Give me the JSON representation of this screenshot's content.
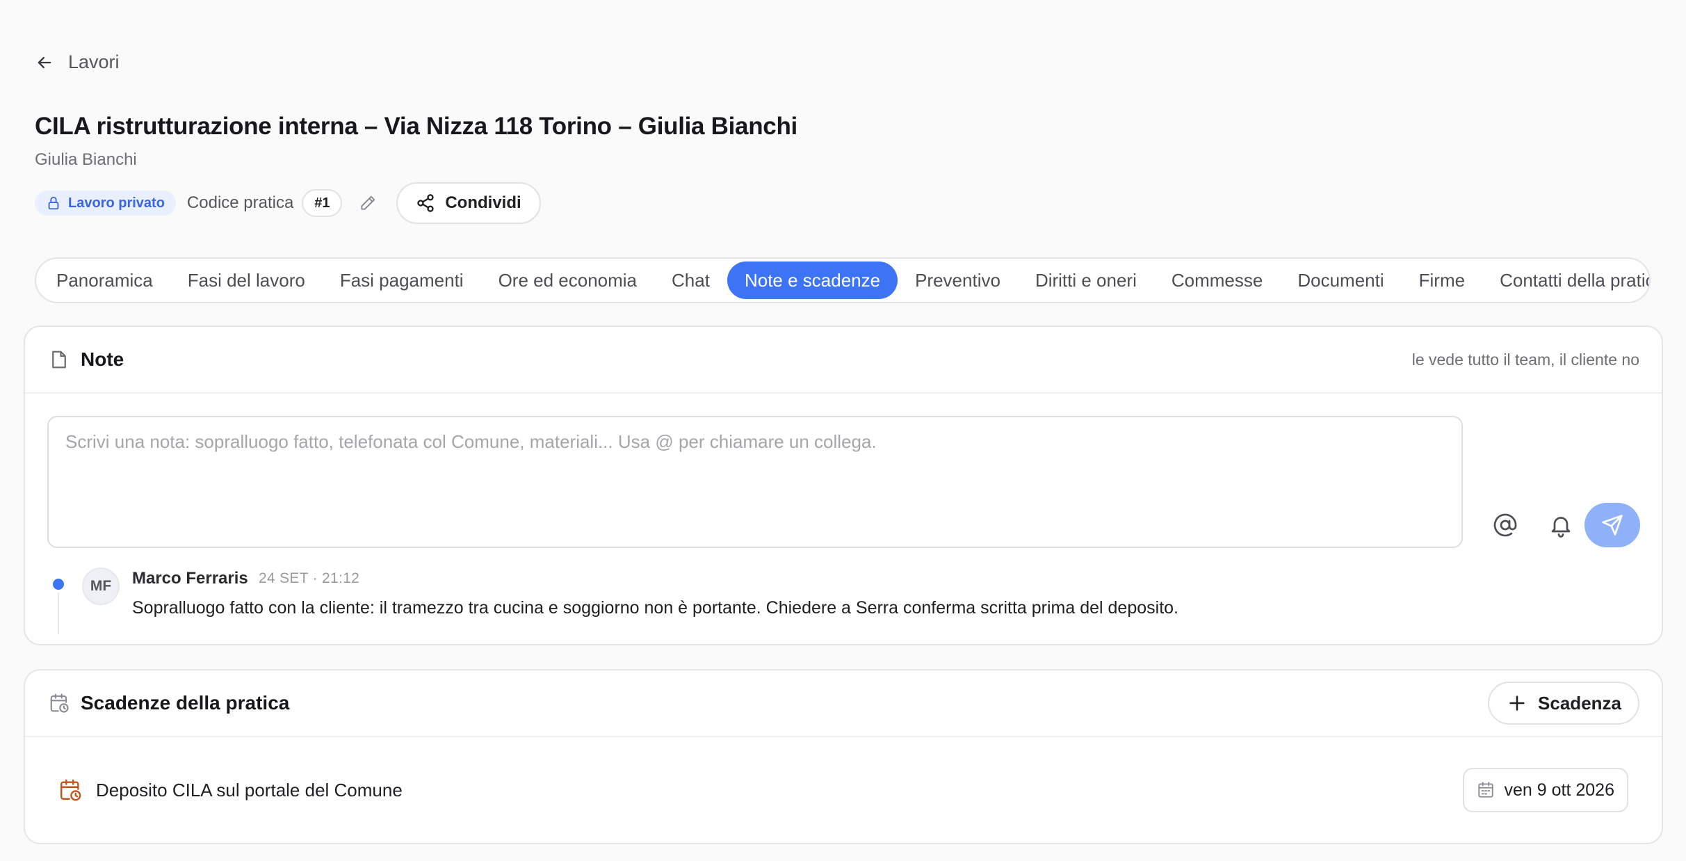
{
  "nav": {
    "back_label": "Lavori",
    "back_icon": "arrow-left-icon"
  },
  "header": {
    "title": "CILA ristrutturazione interna – Via Nizza 118 Torino – Giulia Bianchi",
    "subtitle": "Giulia Bianchi",
    "private_badge": "Lavoro privato",
    "code_label": "Codice pratica",
    "code_value": "#1",
    "share_label": "Condividi"
  },
  "tabs": [
    {
      "label": "Panoramica",
      "active": false
    },
    {
      "label": "Fasi del lavoro",
      "active": false
    },
    {
      "label": "Fasi pagamenti",
      "active": false
    },
    {
      "label": "Ore ed economia",
      "active": false
    },
    {
      "label": "Chat",
      "active": false
    },
    {
      "label": "Note e scadenze",
      "active": true
    },
    {
      "label": "Preventivo",
      "active": false
    },
    {
      "label": "Diritti e oneri",
      "active": false
    },
    {
      "label": "Commesse",
      "active": false
    },
    {
      "label": "Documenti",
      "active": false
    },
    {
      "label": "Firme",
      "active": false
    },
    {
      "label": "Contatti della pratica",
      "active": false
    }
  ],
  "notes": {
    "title": "Note",
    "visibility": "le vede tutto il team, il cliente no",
    "input_placeholder": "Scrivi una nota: sopralluogo fatto, telefonata col Comune, materiali... Usa @ per chiamare un collega.",
    "input_value": "",
    "items": [
      {
        "initials": "MF",
        "author": "Marco Ferraris",
        "time": "24 SET · 21:12",
        "text": "Sopralluogo fatto con la cliente: il tramezzo tra cucina e soggiorno non è portante. Chiedere a Serra conferma scritta prima del deposito."
      }
    ]
  },
  "deadlines": {
    "title": "Scadenze della pratica",
    "add_label": "Scadenza",
    "items": [
      {
        "label": "Deposito CILA sul portale del Comune",
        "date": "ven 9 ott 2026"
      }
    ]
  },
  "colors": {
    "accent": "#3d73f5",
    "send_button": "#8fb1fa",
    "deadline_icon": "#c2541d",
    "private_badge_bg": "#e9effd"
  }
}
